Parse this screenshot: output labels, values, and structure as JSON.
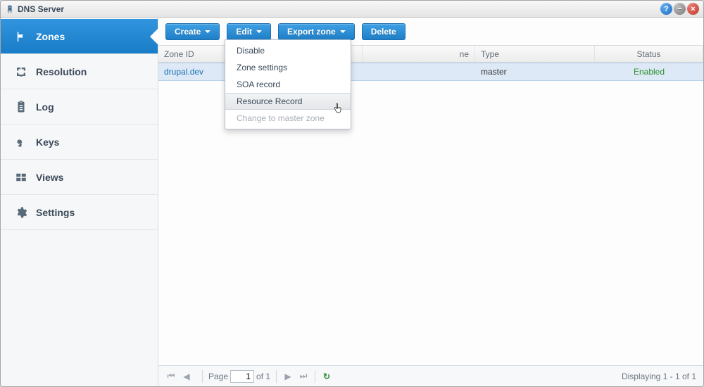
{
  "app": {
    "title": "DNS Server"
  },
  "sidebar": {
    "items": [
      {
        "label": "Zones",
        "icon": "flag-icon",
        "active": true
      },
      {
        "label": "Resolution",
        "icon": "resolution-icon",
        "active": false
      },
      {
        "label": "Log",
        "icon": "clipboard-icon",
        "active": false
      },
      {
        "label": "Keys",
        "icon": "key-icon",
        "active": false
      },
      {
        "label": "Views",
        "icon": "views-icon",
        "active": false
      },
      {
        "label": "Settings",
        "icon": "gear-icon",
        "active": false
      }
    ]
  },
  "toolbar": {
    "create": "Create",
    "edit": "Edit",
    "export": "Export zone",
    "delete": "Delete"
  },
  "edit_menu": {
    "items": [
      {
        "label": "Disable",
        "state": "normal"
      },
      {
        "label": "Zone settings",
        "state": "normal"
      },
      {
        "label": "SOA record",
        "state": "normal"
      },
      {
        "label": "Resource Record",
        "state": "hover"
      },
      {
        "label": "Change to master zone",
        "state": "disabled"
      }
    ]
  },
  "table": {
    "columns": {
      "zone_id": "Zone ID",
      "domain_suffix": "ne",
      "type": "Type",
      "status": "Status"
    },
    "rows": [
      {
        "zone_id": "drupal.dev",
        "domain": "",
        "type": "master",
        "status": "Enabled"
      }
    ]
  },
  "paging": {
    "page_label": "Page",
    "page_value": "1",
    "of_label": "of 1",
    "display": "Displaying 1 - 1 of 1"
  }
}
